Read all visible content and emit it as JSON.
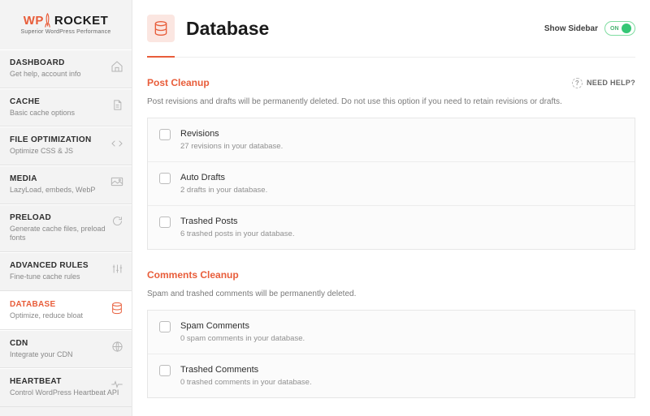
{
  "logo": {
    "wp": "WP",
    "rocket": "ROCKET",
    "tagline": "Superior WordPress Performance"
  },
  "sidebar": {
    "items": [
      {
        "title": "DASHBOARD",
        "sub": "Get help, account info"
      },
      {
        "title": "CACHE",
        "sub": "Basic cache options"
      },
      {
        "title": "FILE OPTIMIZATION",
        "sub": "Optimize CSS & JS"
      },
      {
        "title": "MEDIA",
        "sub": "LazyLoad, embeds, WebP"
      },
      {
        "title": "PRELOAD",
        "sub": "Generate cache files, preload fonts"
      },
      {
        "title": "ADVANCED RULES",
        "sub": "Fine-tune cache rules"
      },
      {
        "title": "DATABASE",
        "sub": "Optimize, reduce bloat"
      },
      {
        "title": "CDN",
        "sub": "Integrate your CDN"
      },
      {
        "title": "HEARTBEAT",
        "sub": "Control WordPress Heartbeat API"
      }
    ]
  },
  "header": {
    "title": "Database",
    "show_sidebar": "Show Sidebar",
    "switch_label": "ON"
  },
  "help": {
    "label": "NEED HELP?"
  },
  "sections": [
    {
      "title": "Post Cleanup",
      "desc": "Post revisions and drafts will be permanently deleted. Do not use this option if you need to retain revisions or drafts.",
      "items": [
        {
          "title": "Revisions",
          "sub": "27 revisions in your database."
        },
        {
          "title": "Auto Drafts",
          "sub": "2 drafts in your database."
        },
        {
          "title": "Trashed Posts",
          "sub": "6 trashed posts in your database."
        }
      ]
    },
    {
      "title": "Comments Cleanup",
      "desc": "Spam and trashed comments will be permanently deleted.",
      "items": [
        {
          "title": "Spam Comments",
          "sub": "0 spam comments in your database."
        },
        {
          "title": "Trashed Comments",
          "sub": "0 trashed comments in your database."
        }
      ]
    }
  ]
}
